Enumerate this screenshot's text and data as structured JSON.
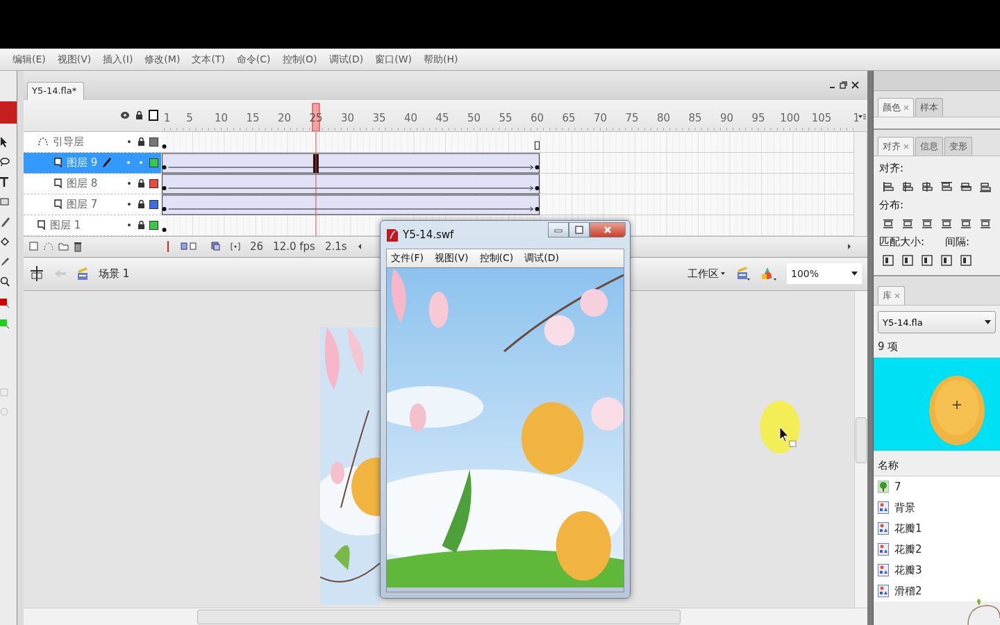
{
  "menu": [
    "编辑(E)",
    "视图(V)",
    "插入(I)",
    "修改(M)",
    "文本(T)",
    "命令(C)",
    "控制(O)",
    "调试(D)",
    "窗口(W)",
    "帮助(H)"
  ],
  "document_tab": {
    "label": "Y5-14.fla*",
    "selected": true
  },
  "timeline": {
    "frame_numbers": [
      {
        "label": "1",
        "selected": false
      },
      {
        "label": "5",
        "selected": false
      },
      {
        "label": "10",
        "selected": false
      },
      {
        "label": "15",
        "selected": false
      },
      {
        "label": "20",
        "selected": false
      },
      {
        "label": "25",
        "selected": true
      },
      {
        "label": "30",
        "selected": false
      },
      {
        "label": "35",
        "selected": false
      },
      {
        "label": "40",
        "selected": false
      },
      {
        "label": "45",
        "selected": false
      },
      {
        "label": "50",
        "selected": false
      },
      {
        "label": "55",
        "selected": false
      },
      {
        "label": "60",
        "selected": false
      },
      {
        "label": "65",
        "selected": false
      },
      {
        "label": "70",
        "selected": false
      },
      {
        "label": "75",
        "selected": false
      },
      {
        "label": "80",
        "selected": false
      },
      {
        "label": "85",
        "selected": false
      },
      {
        "label": "90",
        "selected": false
      },
      {
        "label": "95",
        "selected": false
      },
      {
        "label": "100",
        "selected": false
      },
      {
        "label": "105",
        "selected": false
      },
      {
        "label": "1",
        "selected": false
      }
    ],
    "layers": [
      {
        "name": "引导层",
        "kind": "guide",
        "selected": false,
        "locked": true,
        "tween": false,
        "color": "#777777",
        "children": [
          {
            "name": "图层 9",
            "kind": "normal",
            "selected": true,
            "locked": false,
            "tween": true,
            "color": "#33cc44"
          },
          {
            "name": "图层 8",
            "kind": "normal",
            "selected": false,
            "locked": true,
            "tween": true,
            "color": "#e84a3c"
          },
          {
            "name": "图层 7",
            "kind": "normal",
            "selected": false,
            "locked": true,
            "tween": true,
            "color": "#3a6fe0"
          }
        ]
      },
      {
        "name": "图层 1",
        "kind": "normal",
        "selected": false,
        "locked": true,
        "tween": false,
        "color": "#33cc44"
      }
    ],
    "footer": {
      "current_frame": "26",
      "frame_rate": "12.0 fps",
      "elapsed": "2.1s"
    }
  },
  "edit_bar": {
    "scene": "场景 1",
    "workspace": "工作区",
    "zoom": "100%"
  },
  "swf_window": {
    "title": "Y5-14.swf",
    "menu": [
      "文件(F)",
      "视图(V)",
      "控制(C)",
      "调试(D)"
    ]
  },
  "panels": {
    "color_tabs": [
      {
        "label": "颜色",
        "selected": true
      },
      {
        "label": "样本",
        "selected": false
      }
    ],
    "align_tabs": [
      {
        "label": "对齐",
        "selected": true
      },
      {
        "label": "信息",
        "selected": false
      },
      {
        "label": "变形",
        "selected": false
      }
    ],
    "align_label": "对齐:",
    "distribute_label": "分布:",
    "match_size_label": "匹配大小:",
    "spacing_label": "间隔:"
  },
  "library": {
    "tabs": [
      {
        "label": "库",
        "selected": true
      }
    ],
    "file": "Y5-14.fla",
    "count": "9 项",
    "column": "名称",
    "items": [
      {
        "name": "7",
        "kind": "bitmap"
      },
      {
        "name": "背景",
        "kind": "graphic"
      },
      {
        "name": "花瓣1",
        "kind": "graphic"
      },
      {
        "name": "花瓣2",
        "kind": "graphic"
      },
      {
        "name": "花瓣3",
        "kind": "graphic"
      },
      {
        "name": "滑稽2",
        "kind": "graphic"
      }
    ]
  }
}
